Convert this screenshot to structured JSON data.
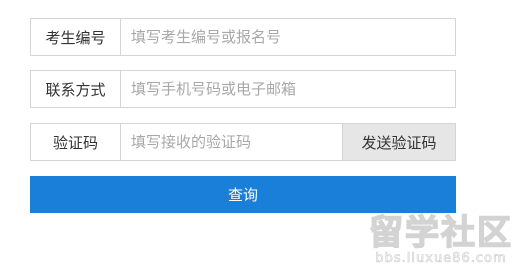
{
  "form": {
    "exam_number": {
      "label": "考生编号",
      "value": "",
      "placeholder": "填写考生编号或报名号"
    },
    "contact": {
      "label": "联系方式",
      "value": "",
      "placeholder": "填写手机号码或电子邮箱"
    },
    "verification": {
      "label": "验证码",
      "value": "",
      "placeholder": "填写接收的验证码",
      "send_label": "发送验证码"
    },
    "query_label": "查询"
  },
  "watermark": {
    "logo_text": "留学社区",
    "url_text": "bbs.liuxue86.com"
  },
  "colors": {
    "primary_button": "#1a7fd8",
    "send_button_bg": "#e6e6e6",
    "border": "#d5d5d5",
    "placeholder": "#a8a8a8"
  }
}
